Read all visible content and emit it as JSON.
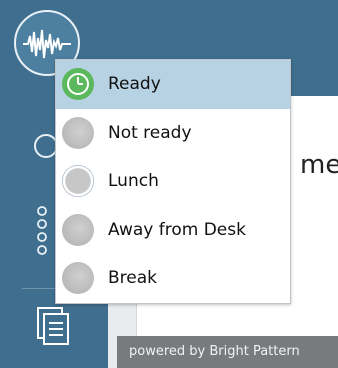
{
  "app": {
    "footer": "powered by Bright Pattern",
    "content_title_fragment": "me"
  },
  "status_menu": {
    "items": [
      {
        "label": "Ready",
        "icon": "clock-icon",
        "color": "#5cb85c",
        "selected": true
      },
      {
        "label": "Not ready",
        "icon": "gray-status-dot",
        "color": "#bdbdbd",
        "selected": false
      },
      {
        "label": "Lunch",
        "icon": "gray-ring-status-dot",
        "color": "#c9cfd6",
        "selected": false
      },
      {
        "label": "Away from Desk",
        "icon": "gray-status-dot",
        "color": "#bdbdbd",
        "selected": false
      },
      {
        "label": "Break",
        "icon": "gray-status-dot",
        "color": "#bdbdbd",
        "selected": false
      }
    ]
  },
  "colors": {
    "sidebar": "#3f6e8e",
    "selected_row": "#b7d2e2",
    "footer_bg": "#777b7e"
  }
}
